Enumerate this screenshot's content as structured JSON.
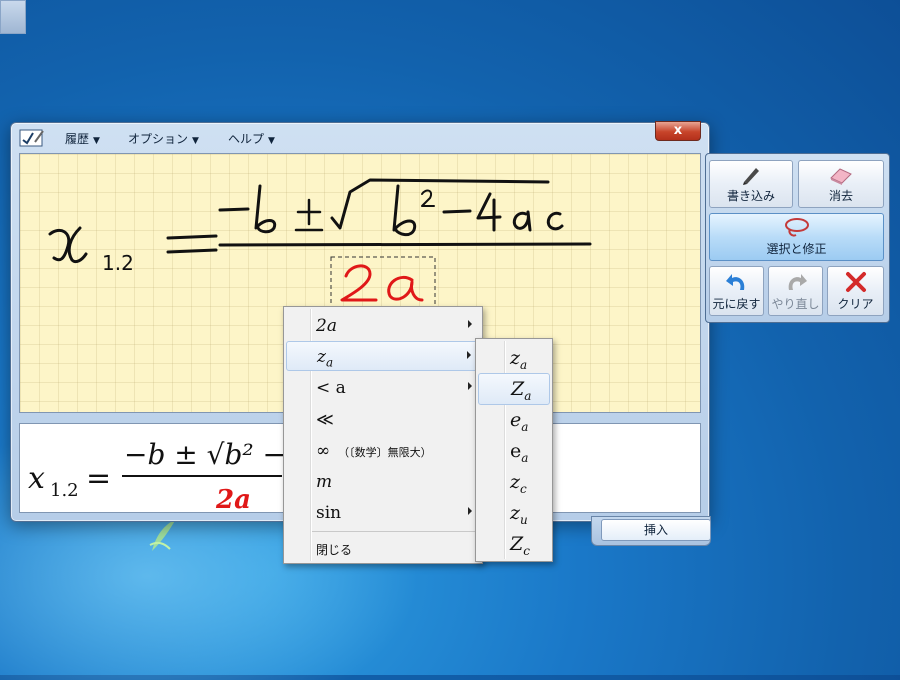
{
  "window": {
    "menus": [
      {
        "label": "履歴"
      },
      {
        "label": "オプション"
      },
      {
        "label": "ヘルプ"
      }
    ],
    "close_label": "x",
    "insert_label": "挿入"
  },
  "tools": {
    "write_label": "書き込み",
    "erase_label": "消去",
    "select_correct_label": "選択と修正",
    "undo_label": "元に戻す",
    "redo_label": "やり直し",
    "clear_label": "クリア"
  },
  "handwriting": {
    "lhs_var": "x",
    "lhs_sub": "1.2",
    "equals": "=",
    "numerator": "−b ± √b²−4ac",
    "selected_denominator": "2a"
  },
  "preview": {
    "lhs_var": "x",
    "lhs_sub": "1.2",
    "equals": "=",
    "numerator": "−b ± √b² −",
    "denominator": "2a"
  },
  "context_menu": {
    "items": [
      {
        "label": "2a",
        "has_submenu": true
      },
      {
        "label": "z",
        "sub": "a",
        "has_submenu": true
      },
      {
        "label": "< a",
        "has_submenu": true
      },
      {
        "label": "≪",
        "has_submenu": false
      },
      {
        "label": "∞",
        "note": "（〔数学〕無限大）",
        "has_submenu": false
      },
      {
        "label": "m",
        "has_submenu": false
      },
      {
        "label": "sin",
        "has_submenu": true
      }
    ],
    "close_label": "閉じる"
  },
  "submenu": {
    "items": [
      {
        "base": "z",
        "sub": "a"
      },
      {
        "base": "Z",
        "sub": "a"
      },
      {
        "base": "e",
        "sub": "a"
      },
      {
        "base": "e",
        "sub": "a"
      },
      {
        "base": "z",
        "sub": "c"
      },
      {
        "base": "z",
        "sub": "u"
      },
      {
        "base": "Z",
        "sub": "c"
      }
    ]
  },
  "colors": {
    "ink": "#111111",
    "correction": "#e01818",
    "accent": "#1a78c8"
  }
}
